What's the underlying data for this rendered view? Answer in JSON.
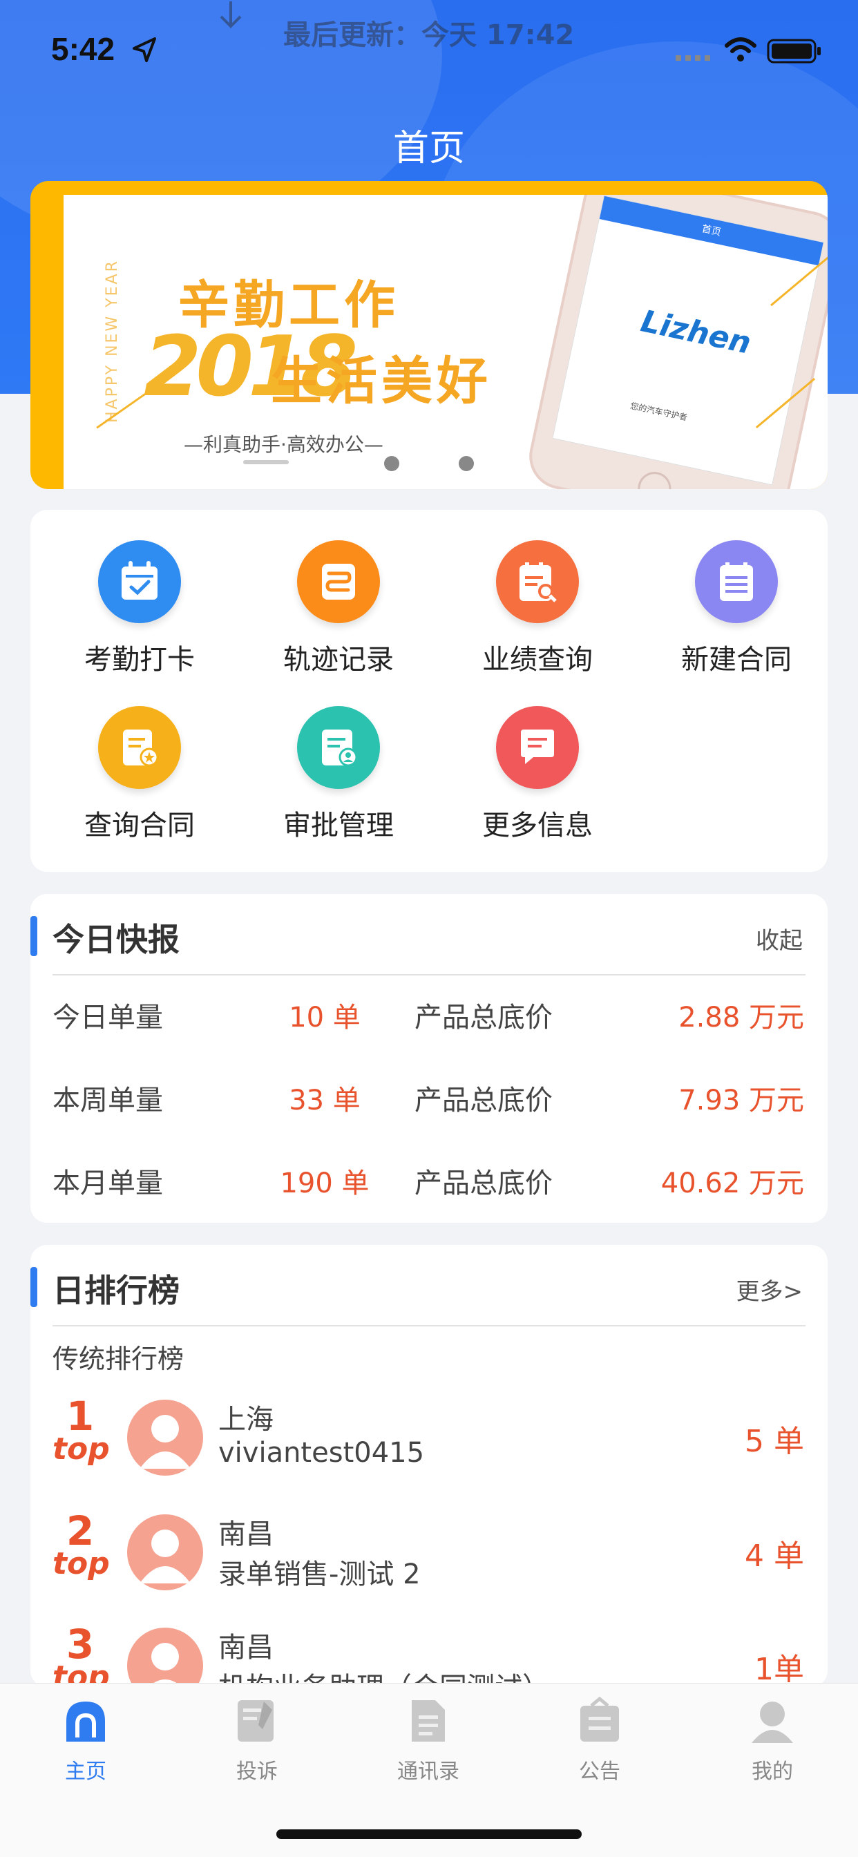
{
  "status_bar": {
    "time": "5:42",
    "refresh_text": "最后更新：今天 17:42"
  },
  "nav": {
    "title": "首页"
  },
  "banner": {
    "vertical_text": "HAPPY NEW YEAR",
    "line1": "辛勤工作",
    "year": "2018",
    "line2": "生活美好",
    "slogan": "—利真助手·高效办公—",
    "phone_title": "首页",
    "phone_logo": "Lizhen",
    "phone_slogan": "您的汽车守护者"
  },
  "grid": {
    "items": [
      {
        "label": "考勤打卡",
        "icon": "calendar-check-icon",
        "color": "#2f8cf0"
      },
      {
        "label": "轨迹记录",
        "icon": "route-icon",
        "color": "#fb8c1a"
      },
      {
        "label": "业绩查询",
        "icon": "report-search-icon",
        "color": "#f56f3f"
      },
      {
        "label": "新建合同",
        "icon": "list-doc-icon",
        "color": "#8a86f2"
      },
      {
        "label": "查询合同",
        "icon": "contract-star-icon",
        "color": "#f6b11a"
      },
      {
        "label": "审批管理",
        "icon": "approval-doc-icon",
        "color": "#2cc2b0"
      },
      {
        "label": "更多信息",
        "icon": "message-icon",
        "color": "#f0585a"
      }
    ]
  },
  "report": {
    "title": "今日快报",
    "action": "收起",
    "rows": [
      {
        "label": "今日单量",
        "count": "10 单",
        "price_label": "产品总底价",
        "price": "2.88 万元"
      },
      {
        "label": "本周单量",
        "count": "33 单",
        "price_label": "产品总底价",
        "price": "7.93 万元"
      },
      {
        "label": "本月单量",
        "count": "190 单",
        "price_label": "产品总底价",
        "price": "40.62 万元"
      }
    ]
  },
  "ranking": {
    "title": "日排行榜",
    "action": "更多>",
    "subtitle": "传统排行榜",
    "top_label": "top",
    "rows": [
      {
        "rank": "1",
        "city": "上海",
        "name": "viviantest0415",
        "count": "5 单"
      },
      {
        "rank": "2",
        "city": "南昌",
        "name": "录单销售-测试 2",
        "count": "4 单"
      },
      {
        "rank": "3",
        "city": "南昌",
        "name": "机构业务助理（合同测试）",
        "count": "1单"
      }
    ]
  },
  "tabbar": {
    "tabs": [
      {
        "label": "主页",
        "icon": "home-icon",
        "active": true
      },
      {
        "label": "投诉",
        "icon": "complaint-icon",
        "active": false
      },
      {
        "label": "通讯录",
        "icon": "contacts-icon",
        "active": false
      },
      {
        "label": "公告",
        "icon": "announcement-icon",
        "active": false
      },
      {
        "label": "我的",
        "icon": "profile-icon",
        "active": false
      }
    ],
    "active_color": "#2f7bf0",
    "inactive_color": "#888888"
  }
}
